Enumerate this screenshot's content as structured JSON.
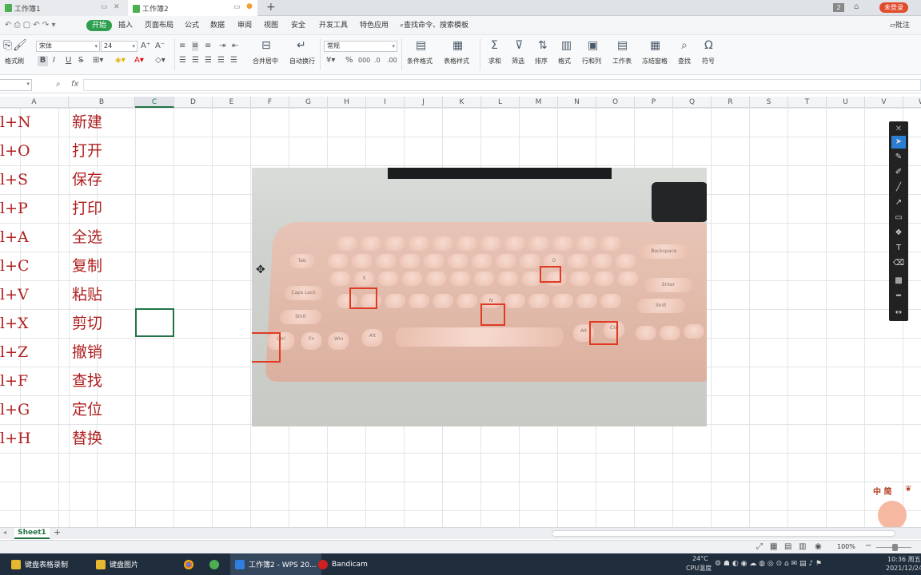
{
  "tabs": [
    {
      "label": "工作簿1",
      "active": false
    },
    {
      "label": "工作簿2",
      "active": true
    }
  ],
  "titlebar": {
    "add_tab": "+",
    "badge": "2",
    "user_button": "未登录"
  },
  "menu": {
    "items": [
      "开始",
      "插入",
      "页面布局",
      "公式",
      "数据",
      "审阅",
      "视图",
      "安全",
      "开发工具",
      "特色应用"
    ],
    "search": "查找命令、搜索模板",
    "comment": "批注"
  },
  "ribbon": {
    "font_name": "宋体",
    "font_size": "24",
    "number_format": "常规",
    "format_painter": "格式刷",
    "merge_center": "合并居中",
    "wrap_text": "自动换行",
    "conditional_format": "条件格式",
    "table_style": "表格样式",
    "sum": "求和",
    "filter": "筛选",
    "sort": "排序",
    "format": "格式",
    "row_col": "行和列",
    "worksheet": "工作表",
    "freeze": "冻结窗格",
    "find": "查找",
    "symbol": "符号",
    "bold": "B",
    "italic": "I",
    "underline": "U"
  },
  "formula_bar": {
    "fx": "fx",
    "value": ""
  },
  "columns": [
    "A",
    "B",
    "C",
    "D",
    "E",
    "F",
    "G",
    "H",
    "I",
    "J",
    "K",
    "L",
    "M",
    "N",
    "O",
    "P",
    "Q",
    "R",
    "S",
    "T",
    "U",
    "V",
    "W"
  ],
  "rows": [
    {
      "a": "l+N",
      "b": "新建"
    },
    {
      "a": "l+O",
      "b": "打开"
    },
    {
      "a": "l+S",
      "b": "保存"
    },
    {
      "a": "l+P",
      "b": "打印"
    },
    {
      "a": "l+A",
      "b": "全选"
    },
    {
      "a": "l+C",
      "b": "复制"
    },
    {
      "a": "l+V",
      "b": "粘贴"
    },
    {
      "a": "l+X",
      "b": "剪切"
    },
    {
      "a": "l+Z",
      "b": "撤销"
    },
    {
      "a": "l+F",
      "b": "查找"
    },
    {
      "a": "l+G",
      "b": "定位"
    },
    {
      "a": "l+H",
      "b": "替换"
    }
  ],
  "photo_keys": {
    "ctrl_left": "Ctrl",
    "fn": "Fn",
    "win": "Win",
    "alt": "Alt",
    "s": "S",
    "n": "N",
    "o": "O",
    "ctrl_right": "Ctrl",
    "caps": "Caps Lock",
    "shift": "Shift",
    "tab": "Tab",
    "enter": "Enter",
    "backspace": "Backspace"
  },
  "sheet": {
    "name": "Sheet1",
    "add": "+"
  },
  "status": {
    "zoom": "100%"
  },
  "watermark": {
    "text": "中 简"
  },
  "taskbar": {
    "items": [
      {
        "label": "键盘表格录制"
      },
      {
        "label": "键盘图片"
      },
      {
        "label": "工作簿2 - WPS 20..."
      },
      {
        "label": "Bandicam"
      }
    ],
    "temp": "24°C",
    "temp_label": "CPU温度",
    "time": "10:36 周五",
    "date": "2021/12/24"
  },
  "colors": {
    "accent": "#2f9e4f",
    "cell_text": "#b02020",
    "highlight": "#e03a25",
    "selection": "#217346"
  }
}
